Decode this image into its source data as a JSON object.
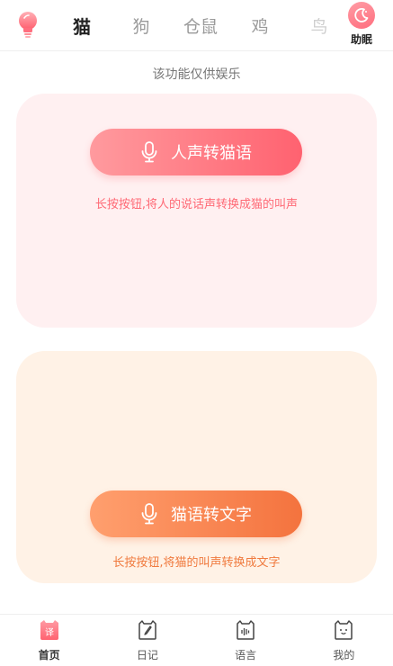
{
  "top_bar": {
    "tabs": [
      "猫",
      "狗",
      "仓鼠",
      "鸡",
      "鸟"
    ],
    "active_tab": "猫",
    "sleep_label": "助眠"
  },
  "notice": "该功能仅供娱乐",
  "voice_card": {
    "button_label": "人声转猫语",
    "hint": "长按按钮,将人的说话声转换成猫的叫声"
  },
  "text_card": {
    "button_label": "猫语转文字",
    "hint": "长按按钮,将猫的叫声转换成文字"
  },
  "bottom_nav": {
    "items": [
      "首页",
      "日记",
      "语言",
      "我的"
    ],
    "home_icon_glyph": "译",
    "active": "首页"
  },
  "colors": {
    "accent_pink": "#ff6e7e",
    "accent_orange": "#f4733e",
    "card_pink_bg": "#fff0f1",
    "card_peach_bg": "#fff2e6"
  },
  "icons": [
    "lightbulb-icon",
    "moon-icon",
    "microphone-icon",
    "translate-icon",
    "diary-icon",
    "cat-language-icon",
    "cat-profile-icon"
  ]
}
